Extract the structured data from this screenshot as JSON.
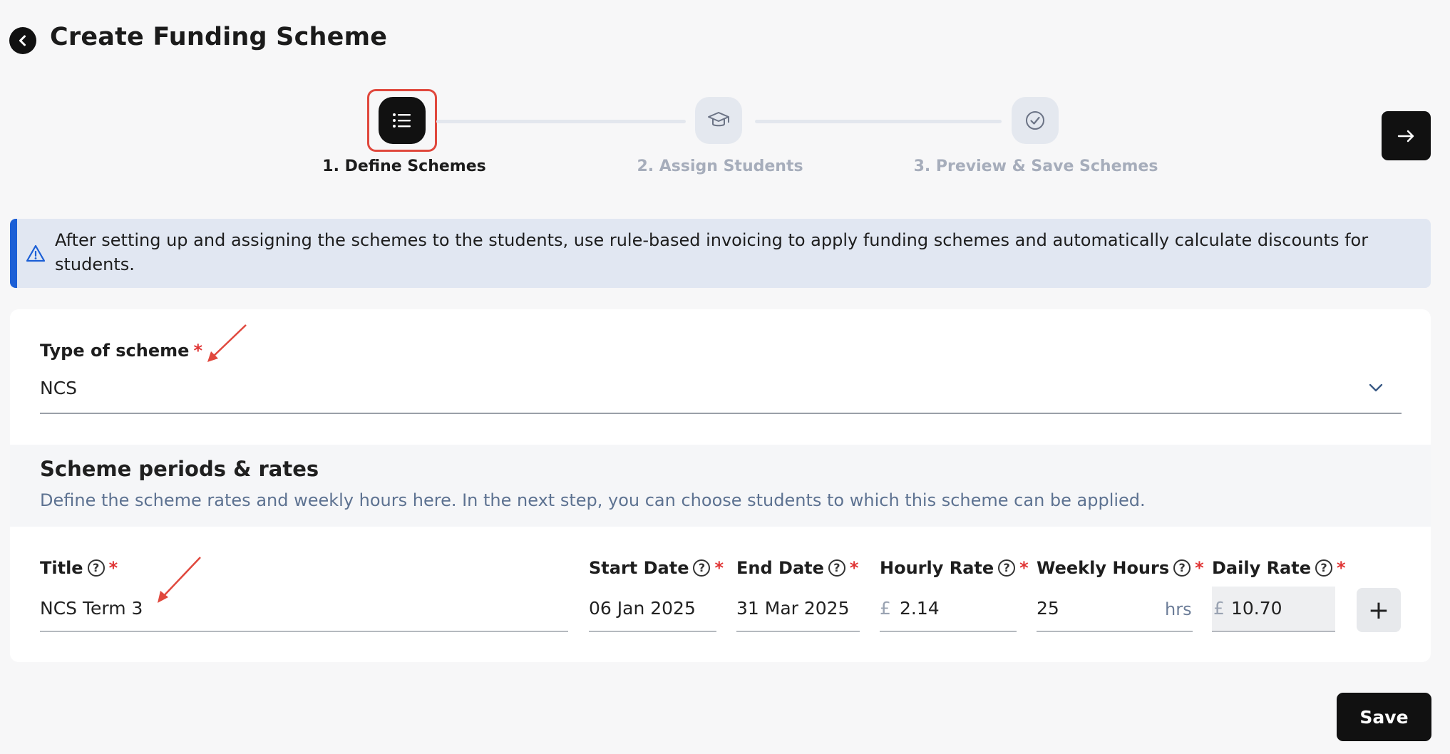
{
  "header": {
    "title": "Create Funding Scheme"
  },
  "stepper": {
    "steps": [
      {
        "label": "1. Define Schemes",
        "icon": "list-icon",
        "state": "active"
      },
      {
        "label": "2. Assign Students",
        "icon": "graduation-cap-icon",
        "state": "inactive"
      },
      {
        "label": "3. Preview & Save Schemes",
        "icon": "check-circle-icon",
        "state": "inactive"
      }
    ]
  },
  "banner": {
    "text": "After setting up and assigning the schemes to the students, use rule-based invoicing to apply funding schemes and automatically calculate discounts for students.",
    "icon": "warning-triangle-icon"
  },
  "scheme_type": {
    "label": "Type of scheme",
    "required": "*",
    "value": "NCS"
  },
  "periods_section": {
    "title": "Scheme periods & rates",
    "description": "Define the scheme rates and weekly hours here. In the next step, you can choose students to which this scheme can be applied."
  },
  "period_row": {
    "title": {
      "label": "Title",
      "value": "NCS Term 3"
    },
    "start_date": {
      "label": "Start Date",
      "value": "06 Jan 2025"
    },
    "end_date": {
      "label": "End Date",
      "value": "31 Mar 2025"
    },
    "hourly_rate": {
      "label": "Hourly Rate",
      "currency": "£",
      "value": "2.14"
    },
    "weekly_hours": {
      "label": "Weekly Hours",
      "value": "25",
      "unit": "hrs"
    },
    "daily_rate": {
      "label": "Daily Rate",
      "currency": "£",
      "value": "10.70"
    },
    "required_mark": "*",
    "help_glyph": "?",
    "add_label": "+"
  },
  "footer": {
    "save_label": "Save"
  },
  "colors": {
    "accent": "#111111",
    "banner_bg": "#e1e7f2",
    "banner_border": "#1b5fd6",
    "required": "#e03434",
    "annotation": "#e0483d"
  }
}
